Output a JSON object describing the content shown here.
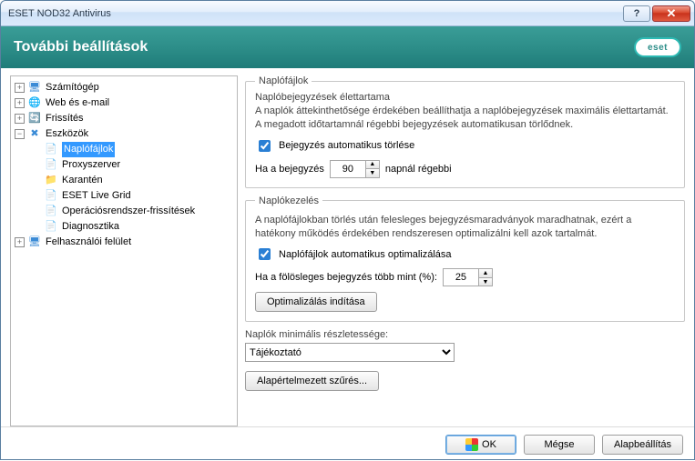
{
  "window": {
    "title": "ESET NOD32 Antivirus"
  },
  "header": {
    "title": "További beállítások",
    "brand": "eset"
  },
  "tree": {
    "items": [
      {
        "label": "Számítógép",
        "depth": 0,
        "twister": "+",
        "icon": "🖥",
        "iconColor": "#3b8bd6"
      },
      {
        "label": "Web és e-mail",
        "depth": 0,
        "twister": "+",
        "icon": "🌐",
        "iconColor": "#3b8bd6"
      },
      {
        "label": "Frissítés",
        "depth": 0,
        "twister": "+",
        "icon": "🔄",
        "iconColor": "#3bbf3b"
      },
      {
        "label": "Eszközök",
        "depth": 0,
        "twister": "−",
        "icon": "✖",
        "iconColor": "#3b8bd6"
      },
      {
        "label": "Naplófájlok",
        "depth": 1,
        "twister": "",
        "icon": "📄",
        "iconColor": "#888",
        "selected": true
      },
      {
        "label": "Proxyszerver",
        "depth": 1,
        "twister": "",
        "icon": "📄",
        "iconColor": "#888"
      },
      {
        "label": "Karantén",
        "depth": 1,
        "twister": "",
        "icon": "📁",
        "iconColor": "#e0a030"
      },
      {
        "label": "ESET Live Grid",
        "depth": 1,
        "twister": "",
        "icon": "📄",
        "iconColor": "#888"
      },
      {
        "label": "Operációsrendszer-frissítések",
        "depth": 1,
        "twister": "",
        "icon": "📄",
        "iconColor": "#888"
      },
      {
        "label": "Diagnosztika",
        "depth": 1,
        "twister": "",
        "icon": "📄",
        "iconColor": "#888"
      },
      {
        "label": "Felhasználói felület",
        "depth": 0,
        "twister": "+",
        "icon": "🖥",
        "iconColor": "#3b8bd6"
      }
    ]
  },
  "logfiles_group": {
    "legend": "Naplófájlok",
    "lifetime_label": "Naplóbejegyzések élettartama",
    "lifetime_desc": "A naplók áttekinthetősége érdekében beállíthatja a naplóbejegyzések maximális élettartamát. A megadott időtartamnál régebbi bejegyzések automatikusan törlődnek.",
    "auto_delete_label": "Bejegyzés automatikus törlése",
    "auto_delete_checked": true,
    "age_prefix": "Ha a bejegyzés",
    "age_value": "90",
    "age_suffix": "napnál régebbi"
  },
  "mgmt_group": {
    "legend": "Naplókezelés",
    "desc": "A naplófájlokban törlés után felesleges bejegyzésmaradványok maradhatnak, ezért a hatékony működés érdekében rendszeresen optimalizálni kell azok tartalmát.",
    "auto_opt_label": "Naplófájlok automatikus optimalizálása",
    "auto_opt_checked": true,
    "thresh_prefix": "Ha a fölösleges bejegyzés több mint (%):",
    "thresh_value": "25",
    "optimize_btn": "Optimalizálás indítása"
  },
  "verbosity": {
    "label": "Naplók minimális részletessége:",
    "value": "Tájékoztató",
    "filter_btn": "Alapértelmezett szűrés..."
  },
  "footer": {
    "ok": "OK",
    "cancel": "Mégse",
    "defaults": "Alapbeállítás"
  }
}
